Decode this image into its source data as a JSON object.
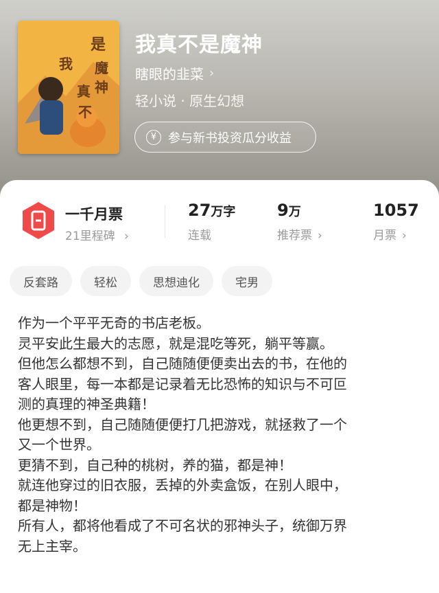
{
  "book": {
    "title": "我真不是魔神",
    "author": "瞎眼的韭菜",
    "genre": "轻小说 · 原生幻想",
    "invest_label": "参与新书投资瓜分收益",
    "cover_text": "我真不是魔神"
  },
  "icons": {
    "author_chevron": "chevron-right-icon",
    "invest": "yen-circle-icon",
    "badge": "ticket-badge-icon"
  },
  "stats": {
    "monthly_title": "一千月票",
    "monthly_sub": "21里程碑",
    "words_num": "27",
    "words_unit": "万字",
    "words_label": "连载",
    "recommend_num": "9",
    "recommend_unit": "万",
    "recommend_label": "推荐票",
    "month_num": "1057",
    "month_label": "月票",
    "chevron": "›"
  },
  "tags": [
    "反套路",
    "轻松",
    "思想迪化",
    "宅男"
  ],
  "synopsis": [
    "作为一个平平无奇的书店老板。",
    "灵平安此生最大的志愿，就是混吃等死，躺平等赢。",
    "但他怎么都想不到，自己随随便便卖出去的书，在他的",
    "客人眼里，每一本都是记录着无比恐怖的知识与不可叵",
    "测的真理的神圣典籍！",
    "他更想不到，自己随随便便打几把游戏，就拯救了一个",
    "又一个世界。",
    "更猜不到，自己种的桃树，养的猫，都是神！",
    "就连他穿过的旧衣服，丢掉的外卖盒饭，在别人眼中，",
    "都是神物！",
    "所有人，都将他看成了不可名状的邪神头子，统御万界",
    "无上主宰。"
  ],
  "colors": {
    "badge_red": "#f0494a",
    "header_top": "#cfcfcb",
    "header_bottom": "#918e86"
  }
}
